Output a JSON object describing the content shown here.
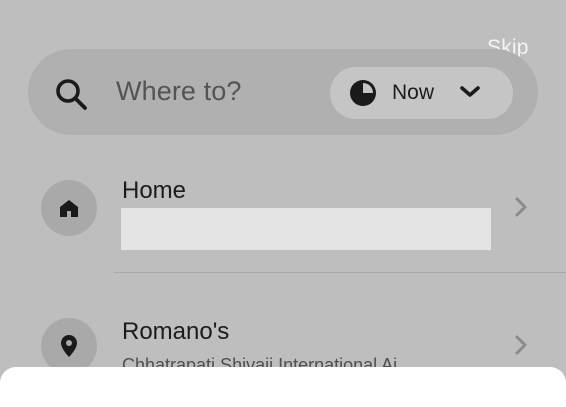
{
  "header": {
    "skip_label": "Skip"
  },
  "search": {
    "placeholder": "Where to?",
    "time_label": "Now"
  },
  "saved_places": [
    {
      "title": "Home",
      "subtitle": "",
      "icon": "home-icon"
    },
    {
      "title": "Romano's",
      "subtitle": "Chhatrapati Shivaji International Ai",
      "icon": "location-pin-icon"
    }
  ],
  "colors": {
    "overlay": "#bebebe",
    "search_bar": "#b0b0b0",
    "time_pill": "#c5c5c5",
    "redaction": "#e4e4e4",
    "sheet": "#ffffff"
  }
}
